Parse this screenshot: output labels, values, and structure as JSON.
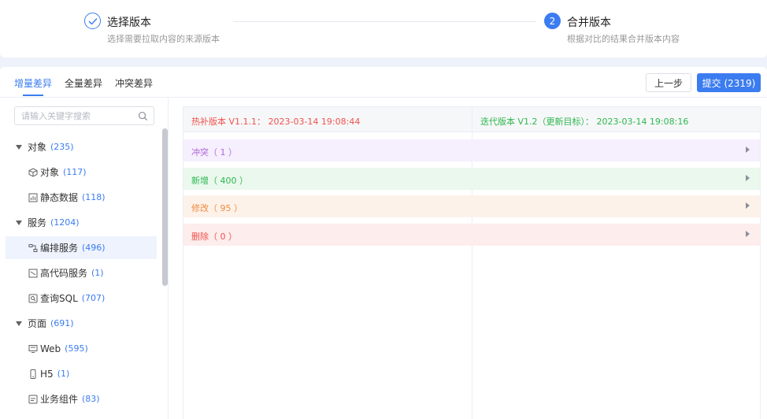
{
  "steps": [
    {
      "title": "选择版本",
      "desc": "选择需要拉取内容的来源版本",
      "state": "done"
    },
    {
      "number": "2",
      "title": "合并版本",
      "desc": "根据对比的结果合并版本内容",
      "state": "active"
    }
  ],
  "tabs": [
    {
      "label": "增量差异",
      "active": true
    },
    {
      "label": "全量差异",
      "active": false
    },
    {
      "label": "冲突差异",
      "active": false
    }
  ],
  "buttons": {
    "prev": "上一步",
    "submit": "提交 (2319)"
  },
  "search": {
    "placeholder": "请输入关键字搜索"
  },
  "tree": [
    {
      "label": "对象",
      "count": "(235)",
      "type": "group"
    },
    {
      "label": "对象",
      "count": "(117)",
      "type": "leaf",
      "icon": "cube-icon"
    },
    {
      "label": "静态数据",
      "count": "(118)",
      "type": "leaf",
      "icon": "chart-icon"
    },
    {
      "label": "服务",
      "count": "(1204)",
      "type": "group"
    },
    {
      "label": "编排服务",
      "count": "(496)",
      "type": "leaf",
      "icon": "flow-icon",
      "selected": true
    },
    {
      "label": "高代码服务",
      "count": "(1)",
      "type": "leaf",
      "icon": "code-icon"
    },
    {
      "label": "查询SQL",
      "count": "(707)",
      "type": "leaf",
      "icon": "sql-icon"
    },
    {
      "label": "页面",
      "count": "(691)",
      "type": "group"
    },
    {
      "label": "Web",
      "count": "(595)",
      "type": "leaf",
      "icon": "monitor-icon"
    },
    {
      "label": "H5",
      "count": "(1)",
      "type": "leaf",
      "icon": "mobile-icon"
    },
    {
      "label": "业务组件",
      "count": "(83)",
      "type": "leaf",
      "icon": "component-icon"
    }
  ],
  "diff": {
    "left_header": "热补版本 V1.1.1： 2023-03-14 19:08:44",
    "right_header": "迭代版本 V1.2（更新目标）： 2023-03-14 19:08:16",
    "rows": [
      {
        "label": "冲突（ 1 ）",
        "color": "#b06ad9",
        "bg": "#f6effd"
      },
      {
        "label": "新增（ 400 ）",
        "color": "#2db84d",
        "bg": "#eaf8ee"
      },
      {
        "label": "修改（ 95 ）",
        "color": "#f08a3c",
        "bg": "#fdf2ea"
      },
      {
        "label": "删除（ 0 ）",
        "color": "#f0524b",
        "bg": "#fdeded"
      }
    ]
  },
  "colors": {
    "accent": "#3b7cf0"
  }
}
